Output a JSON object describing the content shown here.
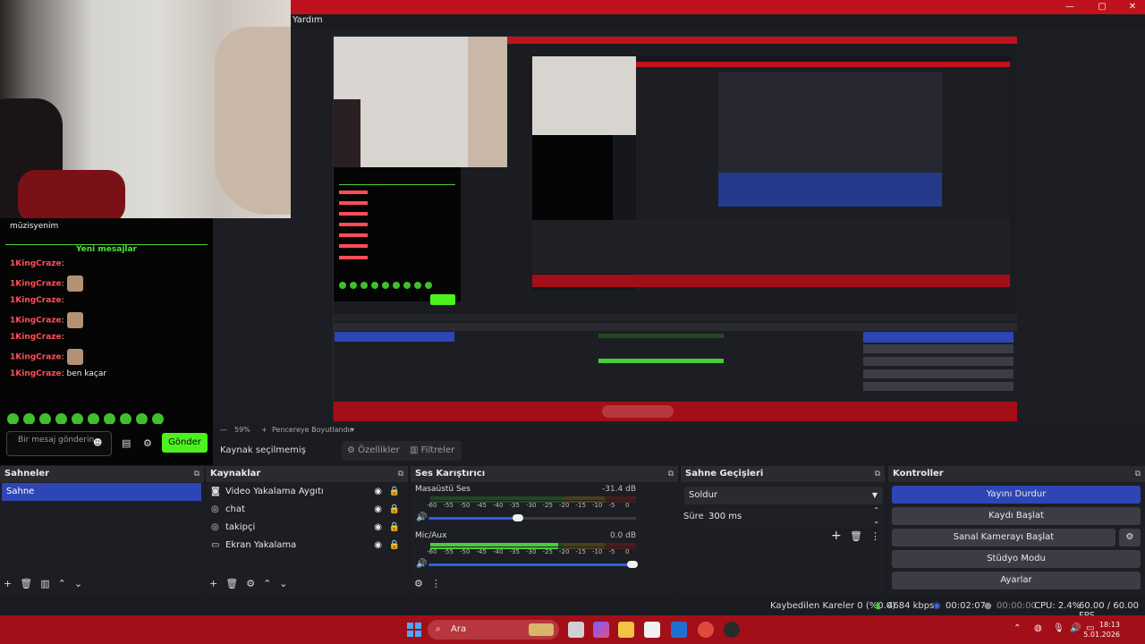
{
  "window": {
    "menu_visible": "Yardım",
    "controls": {
      "minimize": "—",
      "maximize": "▢",
      "close": "✕"
    }
  },
  "chat_widget": {
    "partial_text": "müzisyenim",
    "new_messages_label": "Yeni mesajlar",
    "messages": [
      {
        "user": "1KingCraze",
        "text": ":"
      },
      {
        "user": "1KingCraze",
        "text": ":"
      },
      {
        "user": "1KingCraze",
        "text": ":"
      },
      {
        "user": "1KingCraze",
        "text": ":"
      },
      {
        "user": "1KingCraze",
        "text": ":"
      },
      {
        "user": "1KingCraze",
        "text": ":"
      },
      {
        "user": "1KingCraze",
        "text": ": ben kaçar"
      }
    ],
    "input_placeholder": "Bir mesaj gönderin",
    "send_label": "Gönder"
  },
  "preview": {
    "zoom": "59%",
    "fit_label": "Pencereye Boyutlandır"
  },
  "context_bar": {
    "no_source": "Kaynak seçilmemiş",
    "properties_label": "Özellikler",
    "filters_label": "Filtreler"
  },
  "scenes": {
    "title": "Sahneler",
    "items": [
      "Sahne"
    ]
  },
  "sources": {
    "title": "Kaynaklar",
    "items": [
      {
        "name": "Video Yakalama Aygıtı",
        "icon": "camera-icon"
      },
      {
        "name": "chat",
        "icon": "globe-icon"
      },
      {
        "name": "takipçi",
        "icon": "globe-icon"
      },
      {
        "name": "Ekran Yakalama",
        "icon": "monitor-icon"
      }
    ]
  },
  "mixer": {
    "title": "Ses Karıştırıcı",
    "channels": [
      {
        "name": "Masaüstü Ses",
        "db": "-31.4 dB",
        "level": 0.0,
        "volume": 0.45
      },
      {
        "name": "Mic/Aux",
        "db": "0.0 dB",
        "level": 0.62,
        "volume": 1.0
      }
    ],
    "scale": [
      "-60",
      "-55",
      "-50",
      "-45",
      "-40",
      "-35",
      "-30",
      "-25",
      "-20",
      "-15",
      "-10",
      "-5",
      "0"
    ]
  },
  "transitions": {
    "title": "Sahne Geçişleri",
    "selected": "Soldur",
    "duration_label": "Süre",
    "duration_value": "300 ms"
  },
  "controls": {
    "title": "Kontroller",
    "stop_stream": "Yayını Durdur",
    "start_recording": "Kaydı Başlat",
    "virtual_camera": "Sanal Kamerayı Başlat",
    "studio_mode": "Stüdyo Modu",
    "settings": "Ayarlar"
  },
  "status": {
    "dropped_frames": "Kaybedilen Kareler 0 (%0.0)",
    "bitrate": "4684 kbps",
    "stream_time": "00:02:07",
    "record_time": "00:00:00",
    "cpu": "CPU: 2.4%",
    "fps": "60.00 / 60.00 FPS"
  },
  "taskbar": {
    "search_placeholder": "Ara",
    "time": "18:13",
    "date": "5.01.2026"
  },
  "colors": {
    "accent_red": "#c0121d",
    "selection_blue": "#2e45b5",
    "send_green": "#4cf21e",
    "chat_username": "#ff4d57"
  }
}
